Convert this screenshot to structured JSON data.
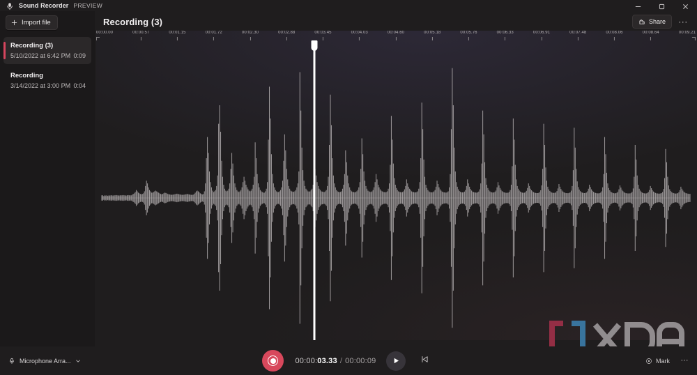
{
  "window": {
    "app_name": "Sound Recorder",
    "preview_tag": "PREVIEW",
    "mic_icon": "microphone-icon",
    "minimize_label": "Minimize",
    "maximize_label": "Restore",
    "close_label": "Close"
  },
  "sidebar": {
    "import_label": "Import file",
    "import_icon": "plus-icon",
    "recordings": [
      {
        "title": "Recording (3)",
        "date": "5/10/2022 at 6:42 PM",
        "duration": "0:09",
        "selected": true
      },
      {
        "title": "Recording",
        "date": "3/14/2022 at 3:00 PM",
        "duration": "0:04",
        "selected": false
      }
    ]
  },
  "header": {
    "title": "Recording (3)",
    "share_label": "Share",
    "share_icon": "share-icon",
    "more_label": "···",
    "more_icon": "ellipsis-icon"
  },
  "timeline": {
    "ticks": [
      "00:00.00",
      "00:00.57",
      "00:01.15",
      "00:01.72",
      "00:02.30",
      "00:02.88",
      "00:03.45",
      "00:04.03",
      "00:04.60",
      "00:05.18",
      "00:05.76",
      "00:06.33",
      "00:06.91",
      "00:07.48",
      "00:08.06",
      "00:08.64",
      "00:09.21"
    ],
    "playhead_time": "00:03.33",
    "playhead_fraction": 0.3636
  },
  "transport": {
    "record_label": "Record",
    "record_icon": "record-icon",
    "play_label": "Play",
    "play_icon": "play-icon",
    "skip_back_label": "Skip back",
    "skip_back_icon": "skip-previous-icon",
    "current_time_prefix": "00:00:",
    "current_time_seconds": "03.33",
    "time_separator": "/",
    "total_time": "00:00:09"
  },
  "footer": {
    "mic_device": "Microphone Arra...",
    "mic_icon": "microphone-icon",
    "mic_chevron_icon": "chevron-down-icon",
    "mark_label": "Mark",
    "mark_icon": "marker-flag-icon",
    "more_label": "···",
    "more_icon": "ellipsis-icon"
  },
  "watermark": {
    "text": "XDA",
    "bracket_left_color": "#9e3048",
    "bracket_right_color": "#3b7ba8",
    "letters_color": "#9a9698"
  },
  "colors": {
    "accent_red": "#d8485c",
    "window_bg": "#1f1d1e",
    "sidebar_bg": "#1b191a",
    "stage_top": "#2b2935",
    "stage_bottom": "#2b2627",
    "waveform": "#b9b4b6",
    "playhead": "#ffffff"
  },
  "waveform_peaks": [
    0.02,
    0.02,
    0.015,
    0.02,
    0.018,
    0.02,
    0.016,
    0.02,
    0.018,
    0.02,
    0.02,
    0.018,
    0.02,
    0.02,
    0.022,
    0.02,
    0.02,
    0.018,
    0.02,
    0.02,
    0.02,
    0.022,
    0.02,
    0.02,
    0.018,
    0.02,
    0.022,
    0.02,
    0.02,
    0.02,
    0.025,
    0.03,
    0.035,
    0.045,
    0.06,
    0.05,
    0.04,
    0.035,
    0.03,
    0.028,
    0.03,
    0.035,
    0.05,
    0.09,
    0.13,
    0.11,
    0.08,
    0.06,
    0.05,
    0.04,
    0.04,
    0.045,
    0.05,
    0.055,
    0.05,
    0.045,
    0.04,
    0.035,
    0.03,
    0.028,
    0.03,
    0.035,
    0.04,
    0.038,
    0.035,
    0.03,
    0.028,
    0.026,
    0.025,
    0.024,
    0.025,
    0.026,
    0.028,
    0.03,
    0.032,
    0.03,
    0.028,
    0.026,
    0.025,
    0.024,
    0.024,
    0.025,
    0.026,
    0.028,
    0.03,
    0.028,
    0.026,
    0.025,
    0.024,
    0.023,
    0.025,
    0.03,
    0.04,
    0.05,
    0.055,
    0.05,
    0.042,
    0.035,
    0.03,
    0.027,
    0.03,
    0.05,
    0.11,
    0.3,
    0.46,
    0.34,
    0.2,
    0.12,
    0.08,
    0.055,
    0.045,
    0.05,
    0.06,
    0.09,
    0.17,
    0.56,
    0.7,
    0.5,
    0.28,
    0.16,
    0.1,
    0.07,
    0.055,
    0.05,
    0.055,
    0.07,
    0.11,
    0.22,
    0.34,
    0.26,
    0.17,
    0.11,
    0.08,
    0.06,
    0.05,
    0.045,
    0.05,
    0.06,
    0.08,
    0.12,
    0.16,
    0.13,
    0.1,
    0.08,
    0.065,
    0.055,
    0.05,
    0.055,
    0.07,
    0.1,
    0.16,
    0.42,
    0.3,
    0.18,
    0.11,
    0.08,
    0.06,
    0.05,
    0.045,
    0.04,
    0.04,
    0.05,
    0.07,
    0.12,
    0.44,
    0.84,
    0.6,
    0.33,
    0.18,
    0.11,
    0.08,
    0.06,
    0.05,
    0.045,
    0.045,
    0.05,
    0.06,
    0.08,
    0.13,
    0.28,
    0.48,
    0.36,
    0.22,
    0.14,
    0.09,
    0.07,
    0.055,
    0.05,
    0.048,
    0.046,
    0.05,
    0.06,
    0.08,
    0.11,
    0.2,
    0.95,
    0.66,
    0.38,
    0.21,
    0.13,
    0.09,
    0.07,
    0.06,
    0.05,
    0.048,
    0.05,
    0.06,
    0.07,
    0.1,
    0.15,
    0.22,
    0.17,
    0.12,
    0.09,
    0.07,
    0.06,
    0.05,
    0.048,
    0.046,
    0.045,
    0.05,
    0.06,
    0.09,
    0.16,
    0.4,
    0.78,
    0.55,
    0.3,
    0.17,
    0.11,
    0.08,
    0.06,
    0.05,
    0.046,
    0.044,
    0.046,
    0.05,
    0.07,
    0.1,
    0.18,
    0.36,
    0.27,
    0.17,
    0.11,
    0.08,
    0.06,
    0.05,
    0.046,
    0.044,
    0.043,
    0.045,
    0.05,
    0.06,
    0.08,
    0.12,
    0.22,
    0.45,
    0.33,
    0.2,
    0.13,
    0.09,
    0.07,
    0.055,
    0.05,
    0.046,
    0.045,
    0.05,
    0.06,
    0.08,
    0.12,
    0.18,
    0.14,
    0.1,
    0.08,
    0.065,
    0.055,
    0.05,
    0.046,
    0.044,
    0.043,
    0.045,
    0.05,
    0.07,
    0.11,
    0.25,
    0.62,
    0.44,
    0.26,
    0.15,
    0.1,
    0.075,
    0.06,
    0.05,
    0.046,
    0.044,
    0.043,
    0.045,
    0.05,
    0.065,
    0.09,
    0.14,
    0.11,
    0.085,
    0.07,
    0.06,
    0.05,
    0.046,
    0.044,
    0.042,
    0.042,
    0.044,
    0.05,
    0.07,
    0.12,
    0.3,
    0.72,
    0.52,
    0.29,
    0.16,
    0.1,
    0.075,
    0.06,
    0.05,
    0.045,
    0.043,
    0.042,
    0.044,
    0.05,
    0.06,
    0.085,
    0.13,
    0.105,
    0.08,
    0.065,
    0.055,
    0.048,
    0.044,
    0.042,
    0.041,
    0.041,
    0.043,
    0.05,
    0.08,
    0.18,
    0.52,
    0.98,
    0.7,
    0.38,
    0.2,
    0.12,
    0.085,
    0.065,
    0.052,
    0.046,
    0.043,
    0.042,
    0.043,
    0.048,
    0.06,
    0.09,
    0.14,
    0.11,
    0.085,
    0.068,
    0.056,
    0.048,
    0.044,
    0.042,
    0.041,
    0.04,
    0.042,
    0.048,
    0.065,
    0.11,
    0.26,
    0.66,
    0.48,
    0.27,
    0.15,
    0.1,
    0.075,
    0.06,
    0.05,
    0.045,
    0.042,
    0.041,
    0.042,
    0.046,
    0.056,
    0.08,
    0.12,
    0.095,
    0.075,
    0.062,
    0.052,
    0.046,
    0.042,
    0.04,
    0.039,
    0.039,
    0.04,
    0.046,
    0.06,
    0.1,
    0.24,
    0.6,
    0.44,
    0.25,
    0.14,
    0.09,
    0.07,
    0.056,
    0.048,
    0.043,
    0.04,
    0.039,
    0.04,
    0.044,
    0.054,
    0.075,
    0.11,
    0.09,
    0.07,
    0.058,
    0.05,
    0.044,
    0.04,
    0.038,
    0.037,
    0.037,
    0.038,
    0.044,
    0.058,
    0.095,
    0.22,
    0.56,
    0.4,
    0.23,
    0.13,
    0.085,
    0.065,
    0.053,
    0.046,
    0.041,
    0.039,
    0.038,
    0.039,
    0.042,
    0.052,
    0.072,
    0.105,
    0.085,
    0.068,
    0.056,
    0.048,
    0.042,
    0.039,
    0.037,
    0.036,
    0.036,
    0.038,
    0.042,
    0.055,
    0.09,
    0.21,
    0.53,
    0.38,
    0.22,
    0.125,
    0.082,
    0.063,
    0.051,
    0.044,
    0.04,
    0.038,
    0.037,
    0.038,
    0.041,
    0.05,
    0.07,
    0.1,
    0.082,
    0.065,
    0.054,
    0.046,
    0.041,
    0.038,
    0.036,
    0.035,
    0.035,
    0.036,
    0.04,
    0.05,
    0.08,
    0.18,
    0.46,
    0.33,
    0.19,
    0.11,
    0.075,
    0.058,
    0.048,
    0.042,
    0.038,
    0.036,
    0.035,
    0.036,
    0.039,
    0.047,
    0.065,
    0.095,
    0.078,
    0.062,
    0.051,
    0.044,
    0.039,
    0.036,
    0.035,
    0.034,
    0.034,
    0.035,
    0.038,
    0.047,
    0.072,
    0.16,
    0.4,
    0.29,
    0.17,
    0.1,
    0.07,
    0.055,
    0.046,
    0.04,
    0.037,
    0.035,
    0.034,
    0.035,
    0.038,
    0.045,
    0.06,
    0.09,
    0.074,
    0.059,
    0.049,
    0.042,
    0.038,
    0.035,
    0.034,
    0.033,
    0.033,
    0.034,
    0.037,
    0.045,
    0.068,
    0.15,
    0.37,
    0.27,
    0.16,
    0.095,
    0.066,
    0.052,
    0.044,
    0.039,
    0.036,
    0.034,
    0.033,
    0.034,
    0.036,
    0.043,
    0.058,
    0.085,
    0.07,
    0.056,
    0.047,
    0.04,
    0.036,
    0.034,
    0.032,
    0.031,
    0.031
  ]
}
